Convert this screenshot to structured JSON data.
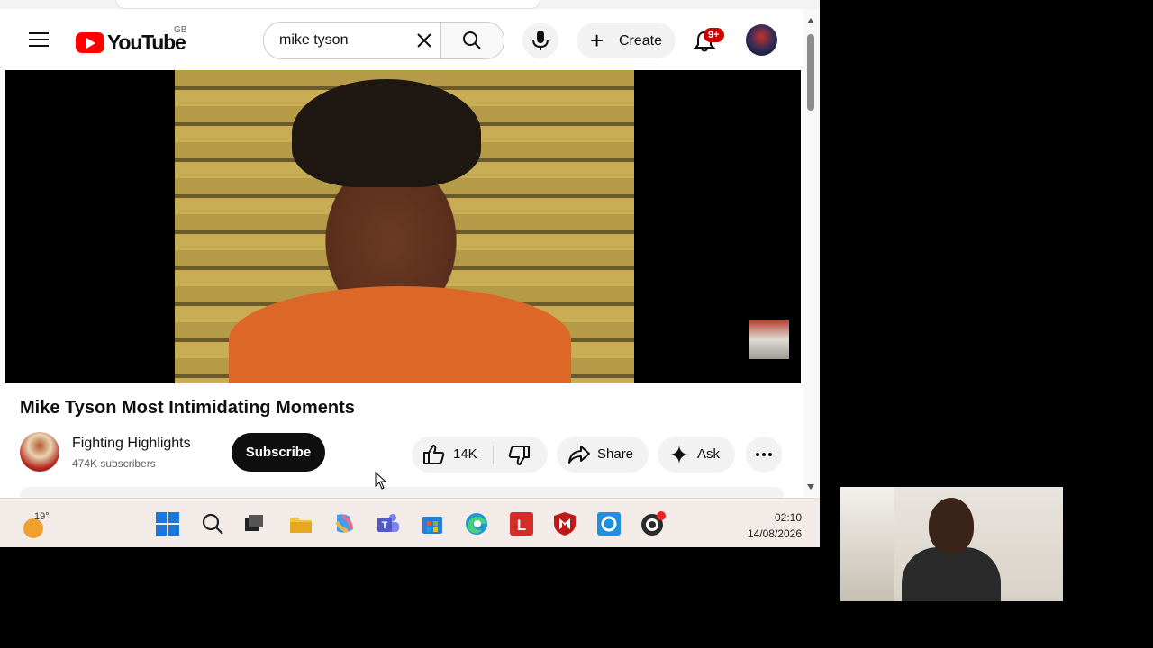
{
  "header": {
    "logo_text": "YouTube",
    "region": "GB",
    "search_value": "mike tyson",
    "create_label": "Create",
    "notification_count": "9+"
  },
  "video": {
    "title": "Mike Tyson Most Intimidating Moments",
    "channel_name": "Fighting Highlights",
    "subscribers": "474K subscribers",
    "subscribe_label": "Subscribe",
    "likes": "14K",
    "share_label": "Share",
    "ask_label": "Ask"
  },
  "taskbar": {
    "temperature": "19°",
    "time": "02:10",
    "date": "14/08/2026"
  },
  "colors": {
    "brand_red": "#ff0000",
    "text_primary": "#0f0f0f",
    "chip_bg": "#f2f2f2"
  }
}
